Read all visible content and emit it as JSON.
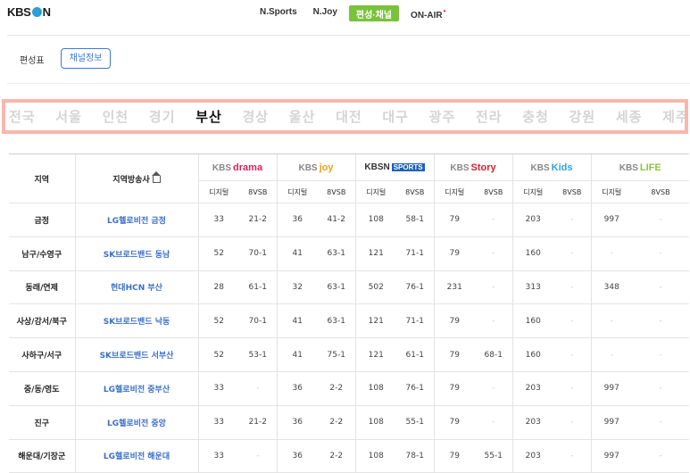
{
  "header": {
    "logo": "KBS ON",
    "logo_left": "KBS",
    "logo_right": "N",
    "nav": [
      {
        "label": "N.Sports"
      },
      {
        "label": "N.Joy"
      },
      {
        "label": "편성·채널",
        "active": true
      },
      {
        "label": "ON-AIR",
        "badge": "•"
      }
    ]
  },
  "subtabs": {
    "schedule": "편성표",
    "channel_info": "채널정보"
  },
  "regions": {
    "items": [
      "전국",
      "서울",
      "인천",
      "경기",
      "부산",
      "경상",
      "울산",
      "대전",
      "대구",
      "광주",
      "전라",
      "충청",
      "강원",
      "세종",
      "제주"
    ],
    "active": "부산"
  },
  "table": {
    "col_region": "지역",
    "col_operator": "지역방송사",
    "channels": [
      {
        "prefix": "KBS",
        "name": "drama"
      },
      {
        "prefix": "KBS",
        "name": "joy"
      },
      {
        "prefix": "KBSN",
        "name": "SPORTS"
      },
      {
        "prefix": "KBS",
        "name": "Story"
      },
      {
        "prefix": "KBS",
        "name": "Kids"
      },
      {
        "prefix": "KBS",
        "name": "LIFE"
      }
    ],
    "sub_digital": "디지털",
    "sub_8vsb": "8VSB",
    "rows": [
      {
        "region": "금정",
        "operator": "LG헬로비전 금정",
        "vals": [
          "33",
          "21-2",
          "36",
          "41-2",
          "108",
          "58-1",
          "79",
          "-",
          "203",
          "-",
          "997",
          "-"
        ]
      },
      {
        "region": "남구/수영구",
        "operator": "SK브로드밴드 동남",
        "vals": [
          "52",
          "70-1",
          "41",
          "63-1",
          "121",
          "71-1",
          "79",
          "-",
          "160",
          "-",
          "-",
          "-"
        ]
      },
      {
        "region": "동래/연제",
        "operator": "현대HCN 부산",
        "vals": [
          "28",
          "61-1",
          "32",
          "63-1",
          "502",
          "76-1",
          "231",
          "-",
          "313",
          "-",
          "348",
          "-"
        ]
      },
      {
        "region": "사상/강서/북구",
        "operator": "SK브로드밴드 낙동",
        "vals": [
          "52",
          "70-1",
          "41",
          "63-1",
          "121",
          "71-1",
          "79",
          "-",
          "160",
          "-",
          "-",
          "-"
        ]
      },
      {
        "region": "사하구/서구",
        "operator": "SK브로드밴드 서부산",
        "vals": [
          "52",
          "53-1",
          "41",
          "75-1",
          "121",
          "61-1",
          "79",
          "68-1",
          "160",
          "-",
          "-",
          "-"
        ]
      },
      {
        "region": "중/동/영도",
        "operator": "LG헬로비전 중부산",
        "vals": [
          "33",
          "-",
          "36",
          "2-2",
          "108",
          "76-1",
          "79",
          "-",
          "203",
          "-",
          "997",
          "-"
        ]
      },
      {
        "region": "진구",
        "operator": "LG헬로비전 중앙",
        "vals": [
          "33",
          "21-2",
          "36",
          "2-2",
          "108",
          "55-1",
          "79",
          "-",
          "203",
          "-",
          "997",
          "-"
        ]
      },
      {
        "region": "해운대/기장군",
        "operator": "LG헬로비전 해운대",
        "vals": [
          "33",
          "-",
          "36",
          "2-2",
          "108",
          "78-1",
          "79",
          "55-1",
          "203",
          "-",
          "997",
          "-"
        ]
      }
    ]
  }
}
